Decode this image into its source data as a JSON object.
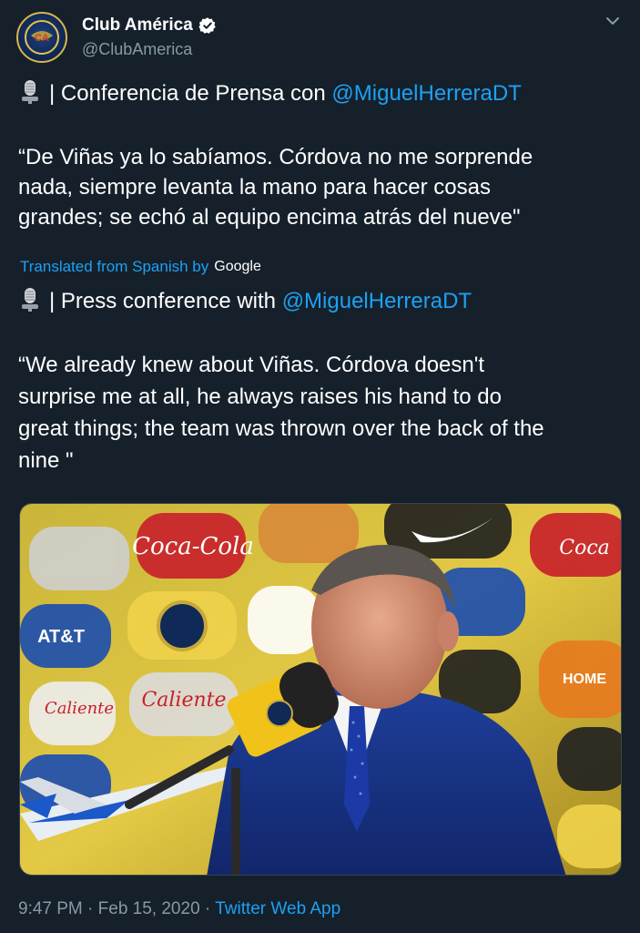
{
  "author": {
    "display_name": "Club América",
    "handle": "@ClubAmerica"
  },
  "original": {
    "line1_prefix": "| Conferencia de Prensa con ",
    "line1_mention": "@MiguelHerreraDT",
    "quote_lines": [
      "“De Viñas ya lo sabíamos. Córdova no me sorprende",
      "nada, siempre levanta la mano para hacer cosas",
      "grandes; se echó al equipo encima atrás del nueve\""
    ]
  },
  "translation": {
    "label": "Translated from Spanish by",
    "provider": "Google",
    "line1_prefix": "| Press conference with ",
    "line1_mention": "@MiguelHerreraDT",
    "quote_lines": [
      " “We already knew about Viñas. Córdova doesn't",
      "surprise me at all, he always raises his hand to do",
      "great things; the team was thrown over the back of the",
      "nine \""
    ]
  },
  "media": {
    "icon": "press-conference-photo",
    "banner_logos": [
      "Coca-Cola",
      "AT&T",
      "Home Depot",
      "Nike",
      "Caliente",
      "Club América"
    ]
  },
  "footer": {
    "time": "9:47 PM",
    "separator": " · ",
    "date": "Feb 15, 2020",
    "app": "Twitter Web App"
  },
  "icons": {
    "verified": "verified-badge-icon",
    "more": "chevron-down-icon",
    "mic": "microphone-icon"
  },
  "colors": {
    "background": "#15202b",
    "link": "#1da1f2",
    "secondary_text": "#8899a6"
  }
}
